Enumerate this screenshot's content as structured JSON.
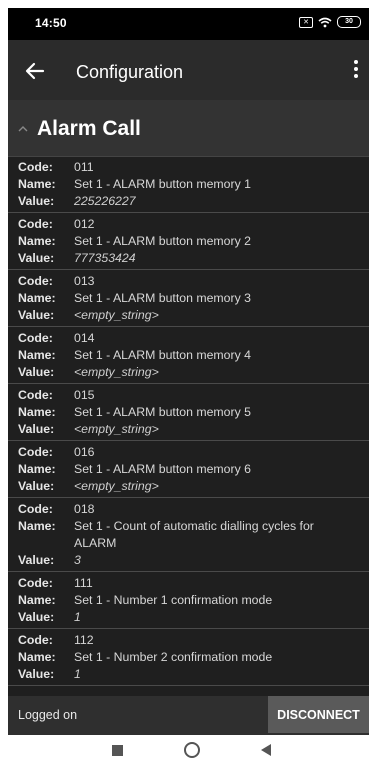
{
  "status_bar": {
    "time": "14:50",
    "battery": "30"
  },
  "app_bar": {
    "title": "Configuration"
  },
  "section": {
    "title": "Alarm Call"
  },
  "labels": {
    "code": "Code:",
    "name": "Name:",
    "value": "Value:"
  },
  "items": [
    {
      "code": "011",
      "name": "Set 1 - ALARM button memory 1",
      "value": "225226227"
    },
    {
      "code": "012",
      "name": "Set 1 - ALARM button memory 2",
      "value": "777353424"
    },
    {
      "code": "013",
      "name": "Set 1 - ALARM button memory 3",
      "value": "<empty_string>"
    },
    {
      "code": "014",
      "name": "Set 1 - ALARM button memory 4",
      "value": "<empty_string>"
    },
    {
      "code": "015",
      "name": "Set 1 - ALARM button memory 5",
      "value": "<empty_string>"
    },
    {
      "code": "016",
      "name": "Set 1 - ALARM button memory 6",
      "value": "<empty_string>"
    },
    {
      "code": "018",
      "name": "Set 1 - Count of automatic dialling cycles for ALARM",
      "value": "3"
    },
    {
      "code": "111",
      "name": "Set 1 - Number 1 confirmation mode",
      "value": "1"
    },
    {
      "code": "112",
      "name": "Set 1 - Number 2 confirmation mode",
      "value": "1"
    }
  ],
  "bottom_bar": {
    "status": "Logged on",
    "disconnect_label": "DISCONNECT"
  },
  "colors": {
    "background": "#1f1f1f",
    "app_bar": "#2b2b2b",
    "section": "#333333",
    "button": "#5a5a5a"
  },
  "icons": [
    "back-arrow-icon",
    "more-vert-icon",
    "chevron-up-icon",
    "wifi-icon",
    "battery-icon",
    "nav-recent-icon",
    "nav-home-icon",
    "nav-back-icon"
  ]
}
